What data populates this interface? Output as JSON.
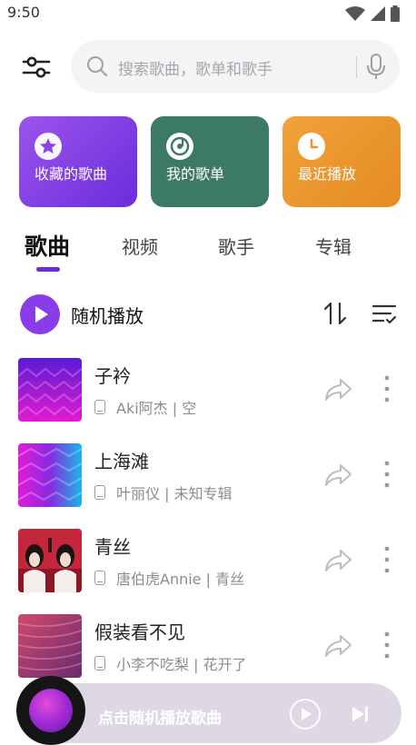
{
  "status_bar": {
    "time": "9:50",
    "icons": [
      "wifi-icon",
      "signal-icon",
      "battery-icon"
    ]
  },
  "search": {
    "placeholder": "搜索歌曲，歌单和歌手"
  },
  "quick_cards": [
    {
      "label": "收藏的歌曲",
      "icon": "star-icon",
      "color": "#8a44e6"
    },
    {
      "label": "我的歌单",
      "icon": "music-disc-icon",
      "color": "#3c7a63"
    },
    {
      "label": "最近播放",
      "icon": "clock-icon",
      "color": "#ea9630"
    }
  ],
  "tabs": [
    {
      "label": "歌曲",
      "active": true
    },
    {
      "label": "视频",
      "active": false
    },
    {
      "label": "歌手",
      "active": false
    },
    {
      "label": "专辑",
      "active": false
    }
  ],
  "shuffle": {
    "label": "随机播放"
  },
  "songs": [
    {
      "title": "子衿",
      "meta": "Aki阿杰 | 空"
    },
    {
      "title": "上海滩",
      "meta": "叶丽仪 | 未知专辑"
    },
    {
      "title": "青丝",
      "meta": "唐伯虎Annie | 青丝"
    },
    {
      "title": "假装看不见",
      "meta": "小李不吃梨 | 花开了"
    }
  ],
  "player": {
    "prompt": "点击随机播放歌曲"
  },
  "colors": {
    "accent": "#6d2cd9",
    "player_bar": "#ddd8e3"
  }
}
